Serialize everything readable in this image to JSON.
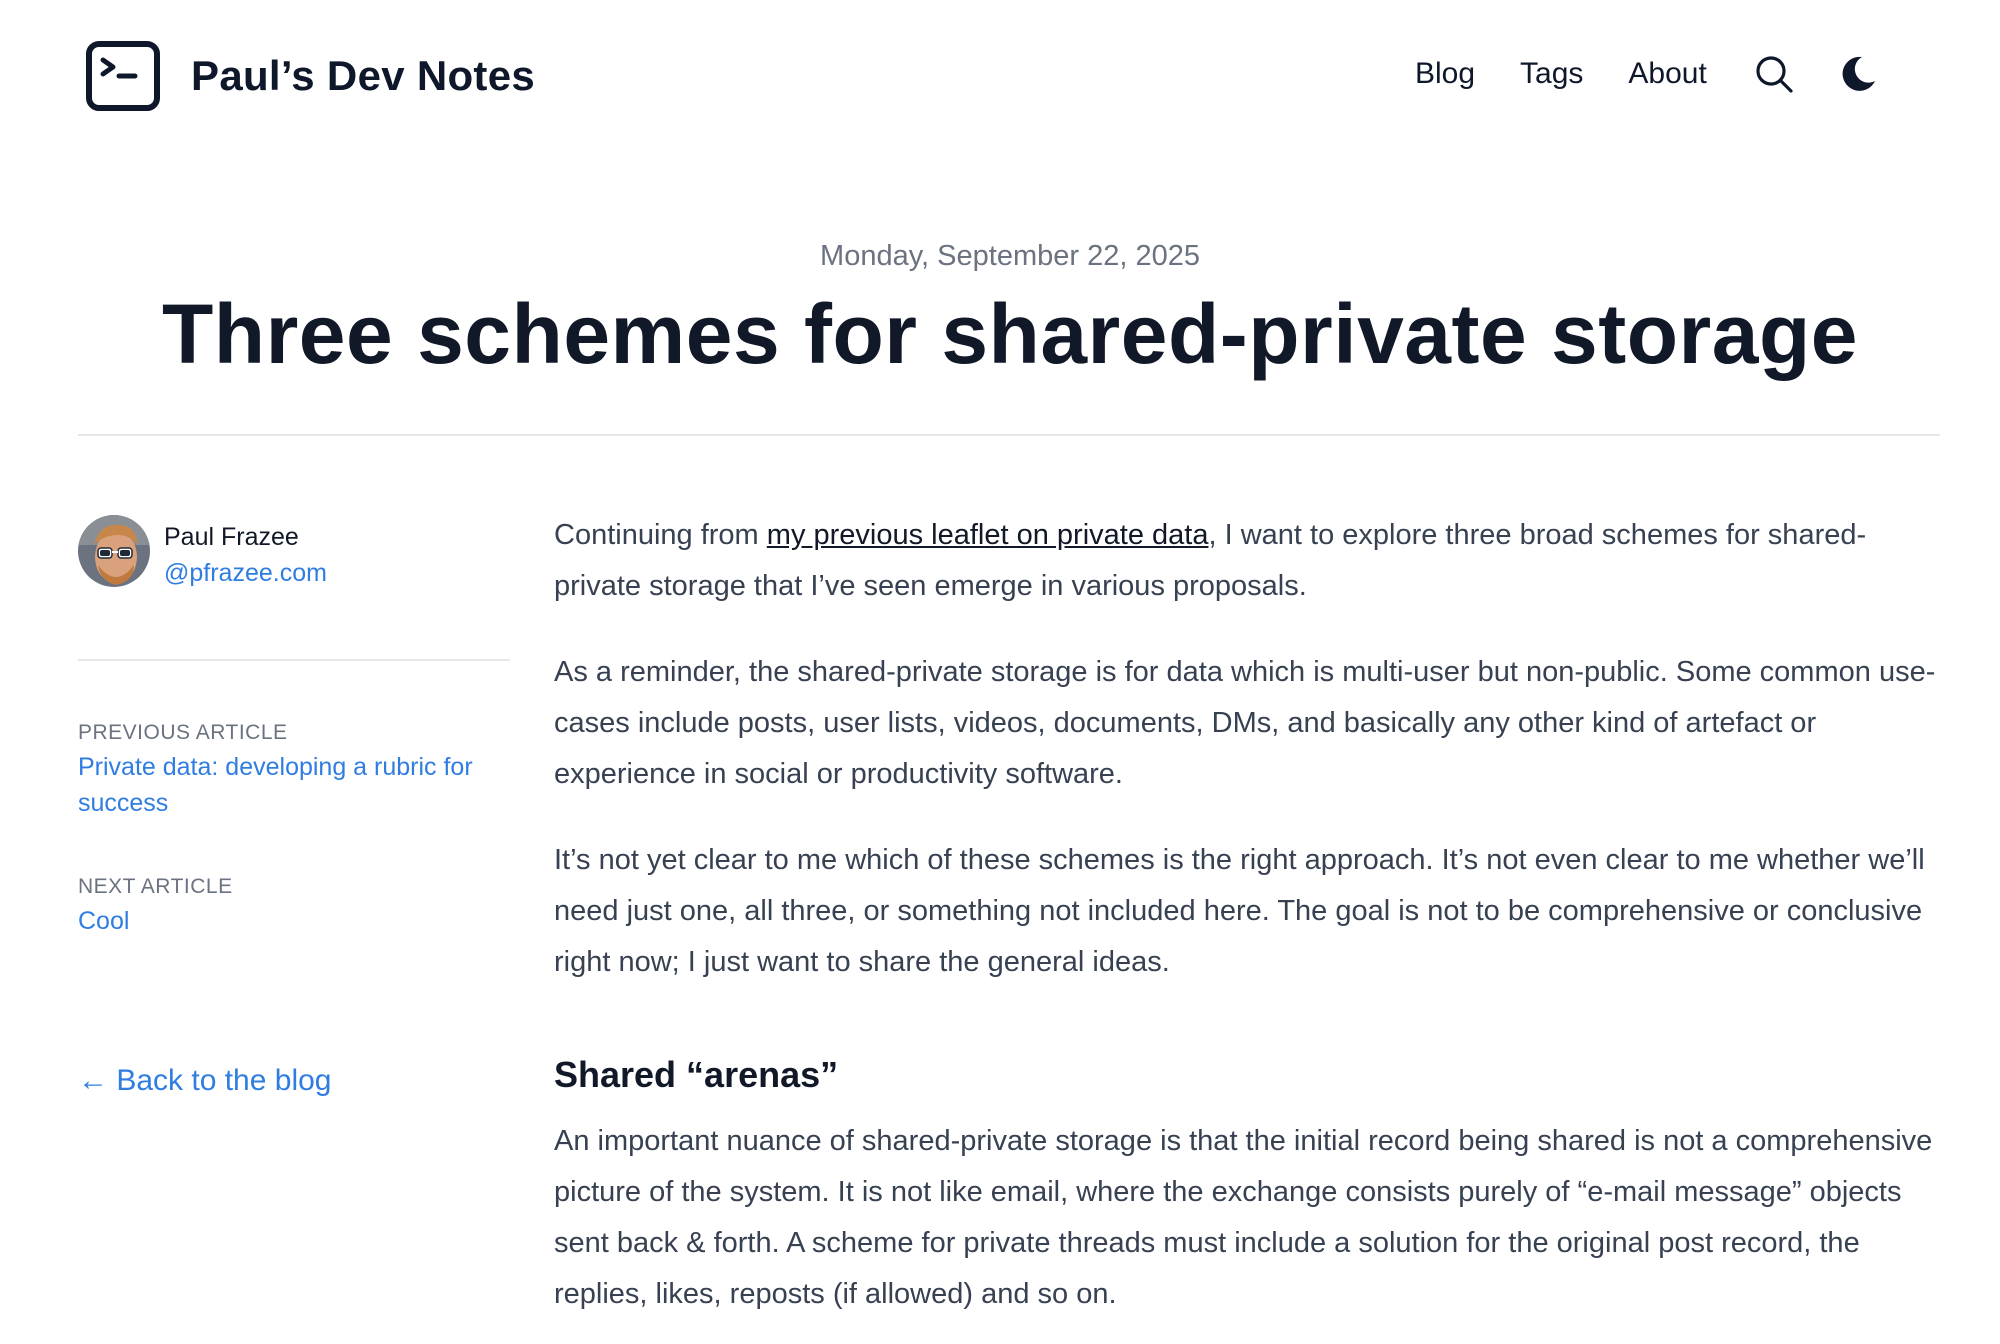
{
  "site": {
    "name": "Paul’s Dev Notes",
    "logo_icon": "terminal-icon"
  },
  "nav": {
    "blog": "Blog",
    "tags": "Tags",
    "about": "About",
    "search_icon": "search-icon",
    "theme_icon": "moon-icon"
  },
  "post": {
    "date": "Monday, September 22, 2025",
    "title": "Three schemes for shared-private storage"
  },
  "author": {
    "name": "Paul Frazee",
    "handle": "@pfrazee.com"
  },
  "sidebar": {
    "previous_label": "PREVIOUS ARTICLE",
    "previous_title": "Private data: developing a rubric for success",
    "next_label": "NEXT ARTICLE",
    "next_title": "Cool",
    "back_link": "← Back to the blog"
  },
  "content": {
    "p1_before": "Continuing from ",
    "p1_link": "my previous leaflet on private data",
    "p1_after": ", I want to explore three broad schemes for shared-private storage that I’ve seen emerge in various proposals.",
    "p2": "As a reminder, the shared-private storage is for data which is multi-user but non-public. Some common use-cases include posts, user lists, videos, documents, DMs, and basically any other kind of artefact or experience in social or productivity software.",
    "p3": "It’s not yet clear to me which of these schemes is the right approach. It’s not even clear to me whether we’ll need just one, all three, or something not included here. The goal is not to be comprehensive or conclusive right now; I just want to share the general ideas.",
    "h2": "Shared “arenas”",
    "p4": "An important nuance of shared-private storage is that the initial record being shared is not a comprehensive picture of the system. It is not like email, where the exchange consists purely of “e-mail message” objects sent back & forth. A scheme for private threads must include a solution for the original post record, the replies, likes, reposts (if allowed) and so on."
  },
  "colors": {
    "link": "#2f7de1",
    "text": "#374151",
    "heading": "#111827",
    "muted": "#6b7280"
  }
}
